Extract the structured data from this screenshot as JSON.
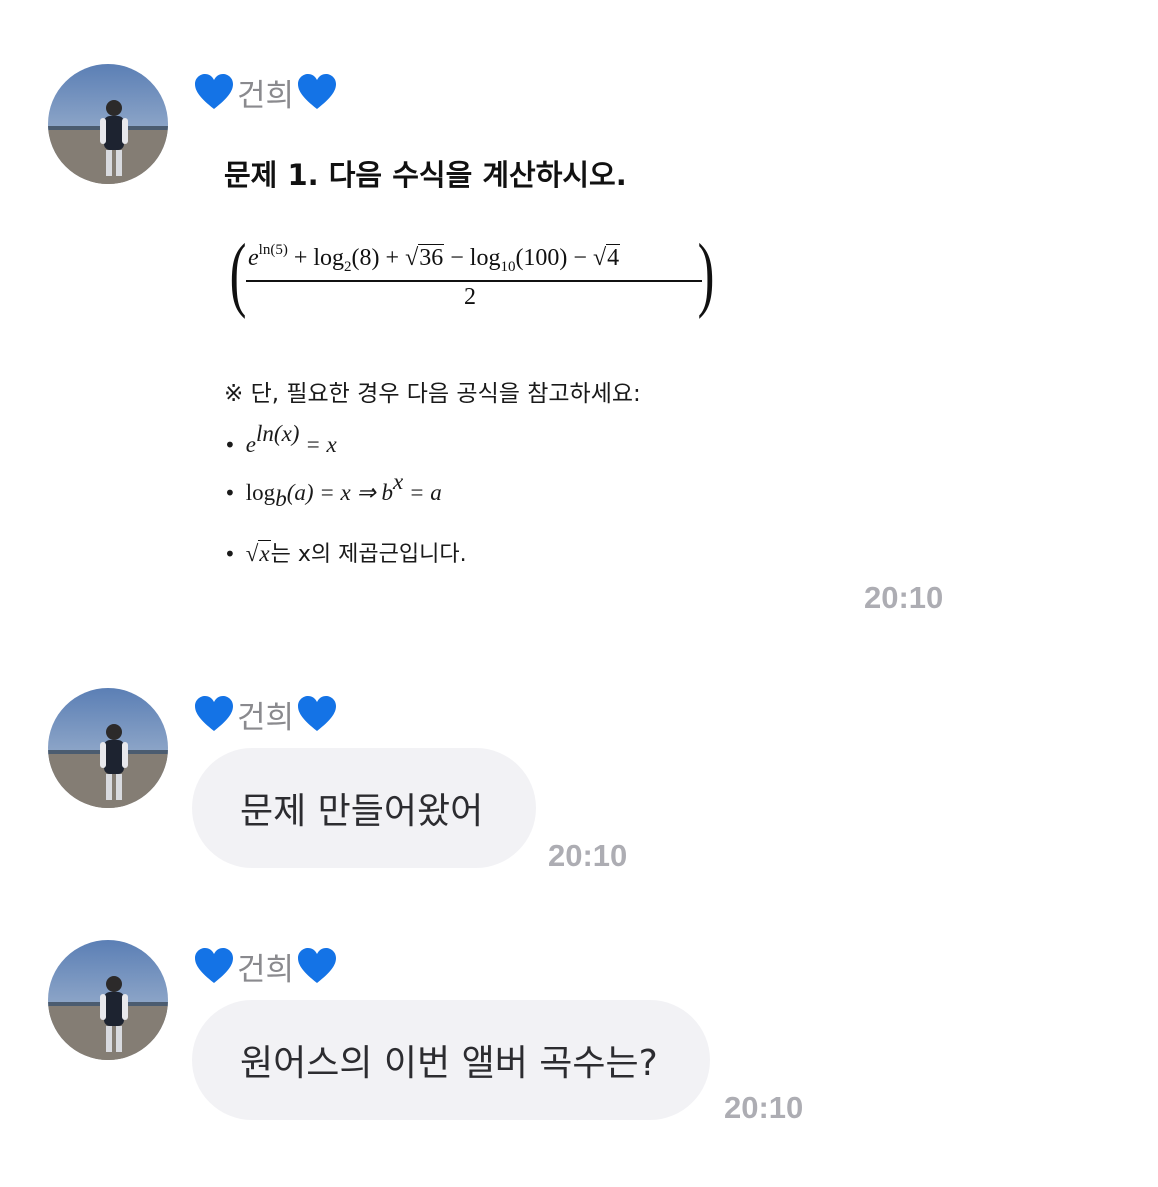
{
  "sender": {
    "name": "건희",
    "heart_color": "#1473e6"
  },
  "messages": [
    {
      "type": "image",
      "problem": {
        "title": "문제 1. 다음 수식을 계산하시오.",
        "numerator": [
          "e",
          "ln(5)",
          " + log",
          "2",
          "(8) + ",
          "√",
          "36",
          " − log",
          "10",
          "(100) − ",
          "√",
          "4"
        ],
        "denominator": "2",
        "note": "※ 단, 필요한 경우 다음 공식을 참고하세요:",
        "formulas": [
          {
            "math": "e",
            "sup": "ln(x)",
            "rest": " = x"
          },
          {
            "math": "log",
            "sub": "b",
            "rest": "(a) = x ⇒ b",
            "sup2": "x",
            "rest2": " = a"
          },
          {
            "root": "x",
            "text": "는 x의 제곱근입니다."
          }
        ]
      },
      "time": "20:10"
    },
    {
      "type": "text",
      "text": "문제 만들어왔어",
      "time": "20:10"
    },
    {
      "type": "text",
      "text": "원어스의 이번 앨버 곡수는?",
      "time": "20:10"
    }
  ]
}
